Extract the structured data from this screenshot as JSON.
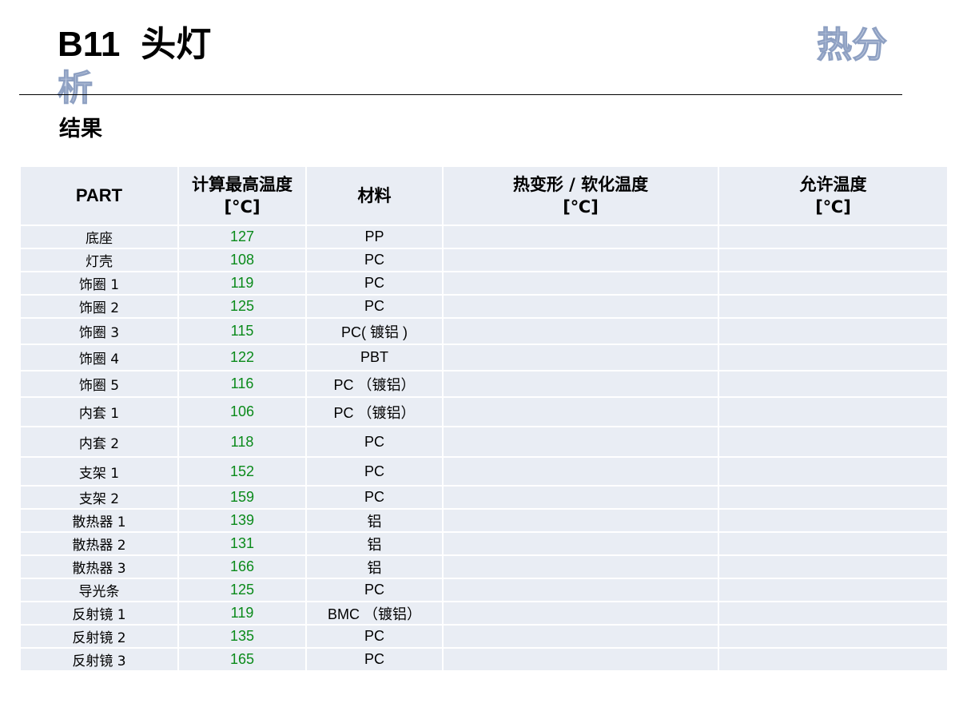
{
  "slide": {
    "title_code": "B11",
    "title_name": "头灯",
    "title_accent_part1": "热分",
    "title_accent_part2": "析",
    "subtitle": "结果"
  },
  "table": {
    "headers": [
      {
        "line1": "PART",
        "line2": ""
      },
      {
        "line1": "计算最高温度",
        "line2": "[°C]"
      },
      {
        "line1": "材料",
        "line2": ""
      },
      {
        "line1": "热变形 / 软化温度",
        "line2": "[℃]"
      },
      {
        "line1": "允许温度",
        "line2": "[℃]"
      }
    ],
    "rows": [
      {
        "part": "底座",
        "temp": "127",
        "material": "PP",
        "softening": "",
        "allowed": ""
      },
      {
        "part": "灯壳",
        "temp": "108",
        "material": "PC",
        "softening": "",
        "allowed": ""
      },
      {
        "part": "饰圈 1",
        "temp": "119",
        "material": "PC",
        "softening": "",
        "allowed": ""
      },
      {
        "part": "饰圈 2",
        "temp": "125",
        "material": "PC",
        "softening": "",
        "allowed": ""
      },
      {
        "part": "饰圈 3",
        "temp": "115",
        "material": "PC( 镀铝 )",
        "softening": "",
        "allowed": ""
      },
      {
        "part": "饰圈 4",
        "temp": "122",
        "material": "PBT",
        "softening": "",
        "allowed": ""
      },
      {
        "part": "饰圈 5",
        "temp": "116",
        "material": "PC （镀铝）",
        "softening": "",
        "allowed": ""
      },
      {
        "part": "内套 1",
        "temp": "106",
        "material": "PC （镀铝）",
        "softening": "",
        "allowed": ""
      },
      {
        "part": "内套 2",
        "temp": "118",
        "material": "PC",
        "softening": "",
        "allowed": ""
      },
      {
        "part": "支架 1",
        "temp": "152",
        "material": "PC",
        "softening": "",
        "allowed": ""
      },
      {
        "part": "支架 2",
        "temp": "159",
        "material": "PC",
        "softening": "",
        "allowed": ""
      },
      {
        "part": "散热器 1",
        "temp": "139",
        "material": "铝",
        "softening": "",
        "allowed": ""
      },
      {
        "part": "散热器 2",
        "temp": "131",
        "material": "铝",
        "softening": "",
        "allowed": ""
      },
      {
        "part": "散热器 3",
        "temp": "166",
        "material": "铝",
        "softening": "",
        "allowed": ""
      },
      {
        "part": "导光条",
        "temp": "125",
        "material": "PC",
        "softening": "",
        "allowed": ""
      },
      {
        "part": "反射镜 1",
        "temp": "119",
        "material": "BMC （镀铝）",
        "softening": "",
        "allowed": ""
      },
      {
        "part": "反射镜 2",
        "temp": "135",
        "material": "PC",
        "softening": "",
        "allowed": ""
      },
      {
        "part": "反射镜 3",
        "temp": "165",
        "material": "PC",
        "softening": "",
        "allowed": ""
      }
    ]
  },
  "colors": {
    "cell_background": "#e9edf4",
    "temperature_text": "#0a8a1a",
    "accent_title": "#c9d3e6"
  }
}
